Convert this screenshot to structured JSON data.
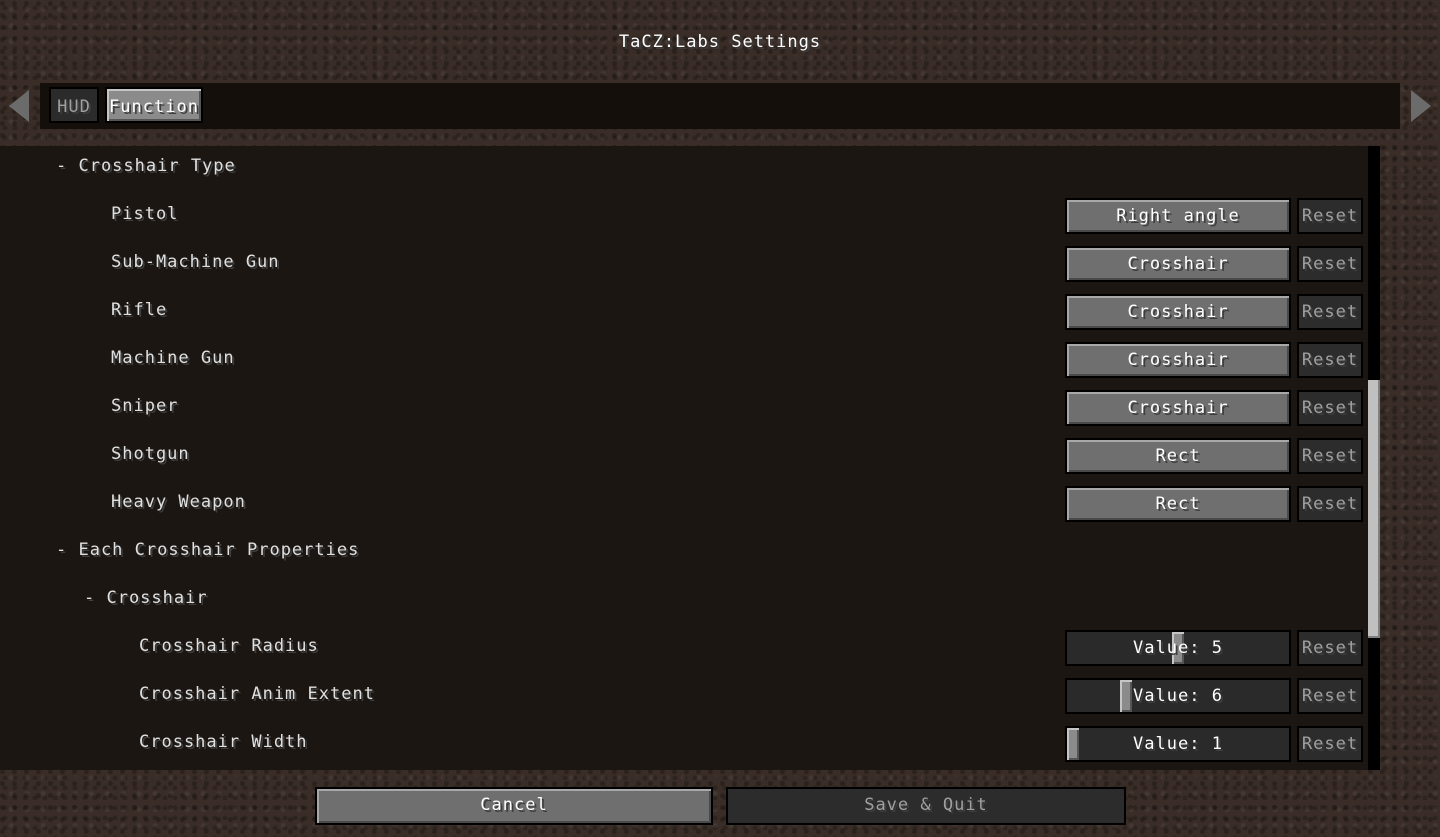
{
  "title": "TaCZ:Labs Settings",
  "tabs": [
    {
      "label": "HUD"
    },
    {
      "label": "Function"
    }
  ],
  "sections": {
    "crosshair_type": "-  Crosshair Type",
    "each_properties": "-  Each Crosshair Properties",
    "crosshair": "-  Crosshair"
  },
  "rows": [
    {
      "label": "Pistol",
      "value": "Right angle",
      "reset": "Reset"
    },
    {
      "label": "Sub-Machine Gun",
      "value": "Crosshair",
      "reset": "Reset"
    },
    {
      "label": "Rifle",
      "value": "Crosshair",
      "reset": "Reset"
    },
    {
      "label": "Machine Gun",
      "value": "Crosshair",
      "reset": "Reset"
    },
    {
      "label": "Sniper",
      "value": "Crosshair",
      "reset": "Reset"
    },
    {
      "label": "Shotgun",
      "value": "Rect",
      "reset": "Reset"
    },
    {
      "label": "Heavy Weapon",
      "value": "Rect",
      "reset": "Reset"
    }
  ],
  "sliders": [
    {
      "label": "Crosshair Radius",
      "value": "Value: 5",
      "reset": "Reset",
      "level": 0.5
    },
    {
      "label": "Crosshair Anim Extent",
      "value": "Value: 6",
      "reset": "Reset",
      "level": 0.25
    },
    {
      "label": "Crosshair Width",
      "value": "Value: 1",
      "reset": "Reset",
      "level": 0.0
    }
  ],
  "footer": {
    "cancel": "Cancel",
    "save_quit": "Save & Quit"
  },
  "icons": {
    "left": "arrow-left-icon",
    "right": "arrow-right-icon"
  }
}
